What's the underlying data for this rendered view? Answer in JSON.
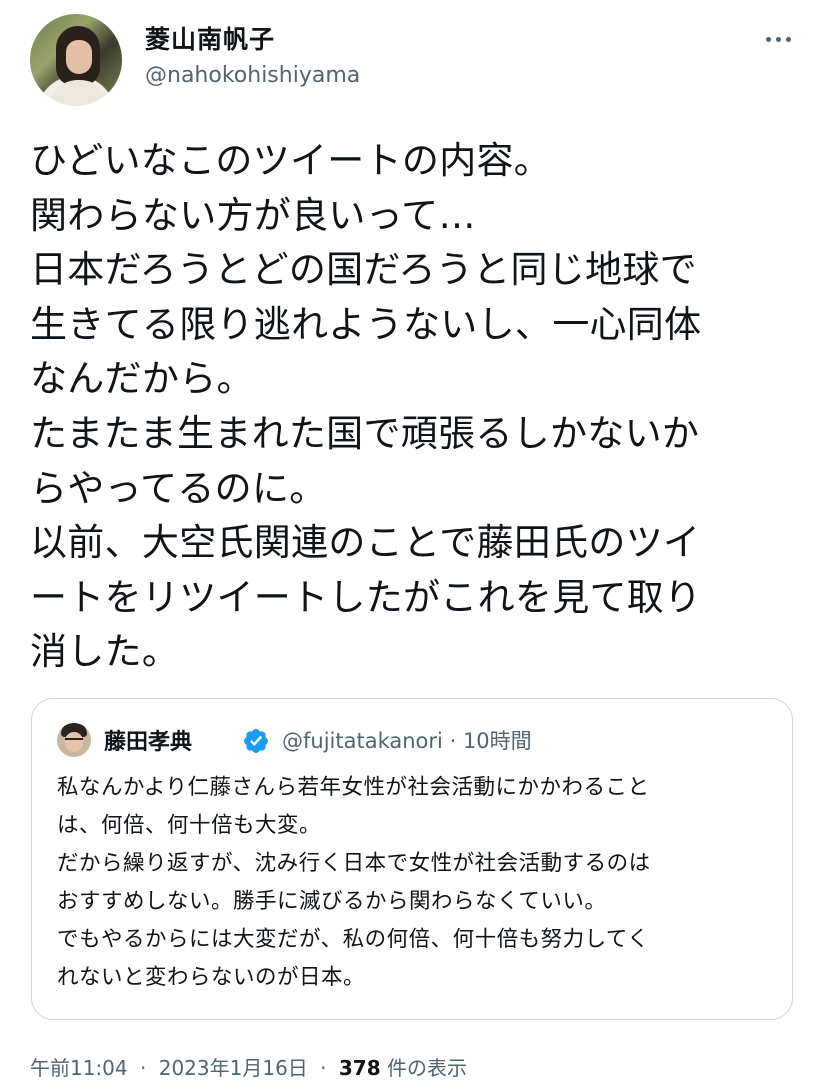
{
  "author": {
    "display_name": "菱山南帆子",
    "handle": "@nahokohishiyama"
  },
  "tweet": {
    "lines": [
      "ひどいなこのツイートの内容。",
      "関わらない方が良いって…",
      "日本だろうとどの国だろうと同じ地球で",
      "生きてる限り逃れようないし、一心同体",
      "なんだから。",
      "たまたま生まれた国で頑張るしかないか",
      "らやってるのに。",
      "以前、大空氏関連のことで藤田氏のツイ",
      "ートをリツイートしたがこれを見て取り",
      "消した。"
    ]
  },
  "quote": {
    "display_name": "藤田孝典",
    "handle": "@fujitatakanori",
    "separator": "·",
    "time": "10時間",
    "verified_color": "#1d9bf0",
    "lines": [
      "私なんかより仁藤さんら若年女性が社会活動にかかわること",
      "は、何倍、何十倍も大変。",
      "だから繰り返すが、沈み行く日本で女性が社会活動するのは",
      "おすすめしない。勝手に滅びるから関わらなくていい。",
      "でもやるからには大変だが、私の何倍、何十倍も努力してく",
      "れないと変わらないのが日本。"
    ]
  },
  "meta": {
    "time": "午前11:04",
    "separator": "·",
    "date": "2023年1月16日",
    "views_count": "378",
    "views_label": "件の表示"
  },
  "icons": {
    "more": "more-dots-icon",
    "verified": "verified-badge-icon"
  }
}
